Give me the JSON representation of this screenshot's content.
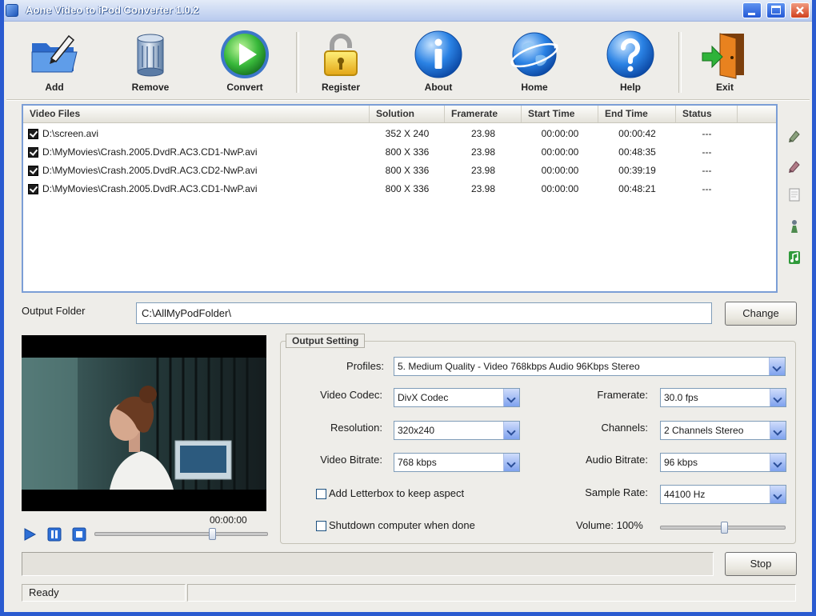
{
  "window": {
    "title": "Aone Video to iPod Converter 1.0.2",
    "controls": [
      "minimize-icon",
      "maximize-icon",
      "close-icon"
    ]
  },
  "toolbar": {
    "items": [
      {
        "label": "Add",
        "icon": "add-folder-icon"
      },
      {
        "label": "Remove",
        "icon": "remove-icon"
      },
      {
        "label": "Convert",
        "icon": "convert-play-icon"
      },
      {
        "label": "Register",
        "icon": "lock-icon"
      },
      {
        "label": "About",
        "icon": "info-icon"
      },
      {
        "label": "Home",
        "icon": "globe-icon"
      },
      {
        "label": "Help",
        "icon": "help-icon"
      },
      {
        "label": "Exit",
        "icon": "exit-door-icon"
      }
    ]
  },
  "file_list": {
    "columns": [
      "Video Files",
      "Solution",
      "Framerate",
      "Start Time",
      "End Time",
      "Status"
    ],
    "rows": [
      {
        "checked": true,
        "file": "D:\\screen.avi",
        "solution": "352 X 240",
        "framerate": "23.98",
        "start": "00:00:00",
        "end": "00:00:42",
        "status": "---"
      },
      {
        "checked": true,
        "file": "D:\\MyMovies\\Crash.2005.DvdR.AC3.CD1-NwP.avi",
        "solution": "800 X 336",
        "framerate": "23.98",
        "start": "00:00:00",
        "end": "00:48:35",
        "status": "---"
      },
      {
        "checked": true,
        "file": "D:\\MyMovies\\Crash.2005.DvdR.AC3.CD2-NwP.avi",
        "solution": "800 X 336",
        "framerate": "23.98",
        "start": "00:00:00",
        "end": "00:39:19",
        "status": "---"
      },
      {
        "checked": true,
        "file": "D:\\MyMovies\\Crash.2005.DvdR.AC3.CD1-NwP.avi",
        "solution": "800 X 336",
        "framerate": "23.98",
        "start": "00:00:00",
        "end": "00:48:21",
        "status": "---"
      }
    ]
  },
  "side_tools": [
    "move-up-icon",
    "move-down-icon",
    "clear-list-icon",
    "person-icon",
    "music-note-icon"
  ],
  "output_folder": {
    "label": "Output Folder",
    "value": "C:\\AllMyPodFolder\\",
    "change_label": "Change"
  },
  "preview": {
    "time": "00:00:00",
    "seek_level": 0.68,
    "controls": [
      "play-icon",
      "pause-icon",
      "stop-icon"
    ]
  },
  "output_setting": {
    "title": "Output Setting",
    "profiles": {
      "label": "Profiles:",
      "value": "5. Medium Quality - Video 768kbps  Audio 96Kbps  Stereo"
    },
    "video_codec": {
      "label": "Video Codec:",
      "value": "DivX Codec"
    },
    "resolution": {
      "label": "Resolution:",
      "value": "320x240"
    },
    "video_bitrate": {
      "label": "Video Bitrate:",
      "value": "768 kbps"
    },
    "framerate": {
      "label": "Framerate:",
      "value": "30.0  fps"
    },
    "channels": {
      "label": "Channels:",
      "value": "2 Channels Stereo"
    },
    "audio_bitrate": {
      "label": "Audio Bitrate:",
      "value": "96  kbps"
    },
    "sample_rate": {
      "label": "Sample Rate:",
      "value": "44100 Hz"
    },
    "letterbox": {
      "label": "Add Letterbox to keep aspect",
      "checked": false
    },
    "shutdown": {
      "label": "Shutdown computer when done",
      "checked": false
    },
    "volume": {
      "label": "Volume: 100%",
      "slider_level": 0.51
    }
  },
  "progress": {
    "value": 0,
    "stop_label": "Stop"
  },
  "status": {
    "text": "Ready",
    "secondary": ""
  },
  "colors": {
    "window_frame": "#2a5bd0",
    "list_border": "#7b9ed6",
    "dropdown_button": "#7fa2ee",
    "convert_green": "#38b83a",
    "background": "#eeede9"
  }
}
